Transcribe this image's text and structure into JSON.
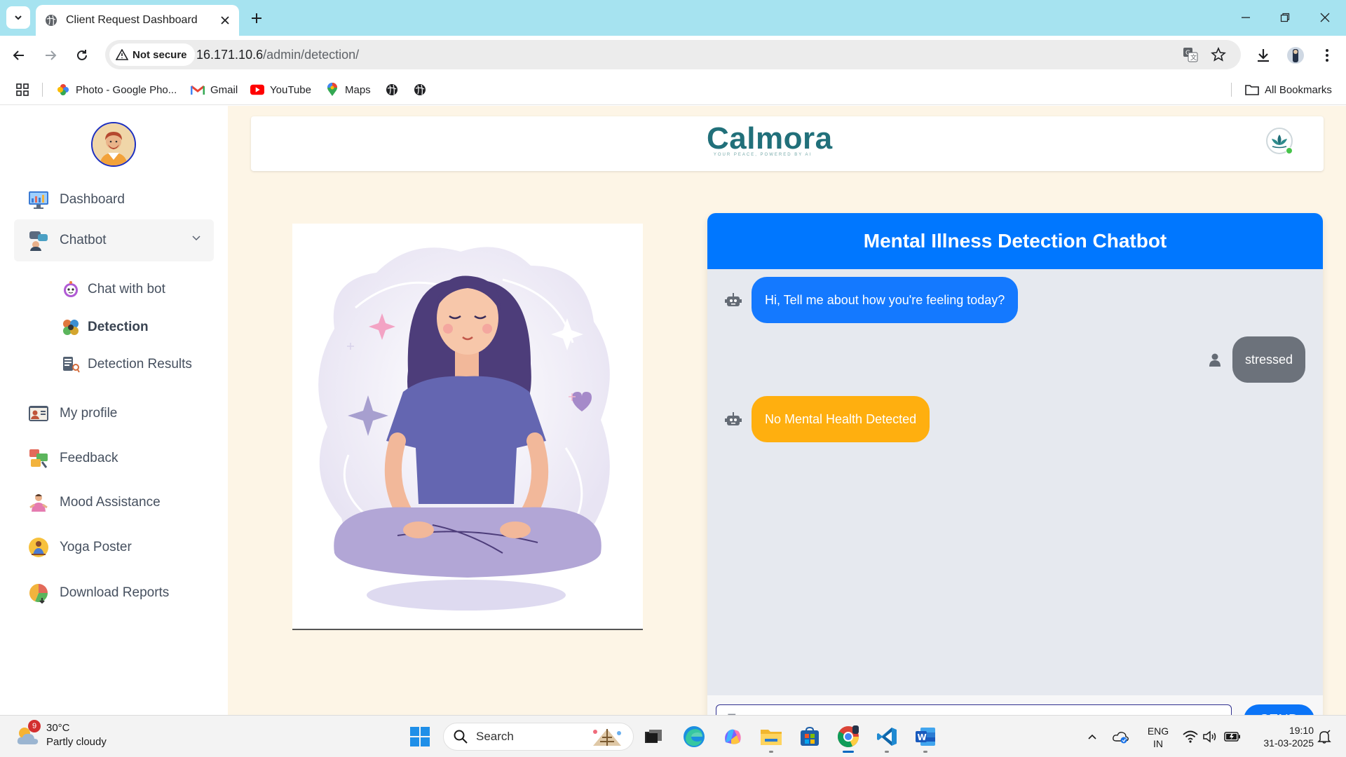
{
  "browser": {
    "tab_title": "Client Request Dashboard",
    "security_label": "Not secure",
    "url_host": "16.171.10.6",
    "url_path": "/admin/detection/",
    "bookmarks": [
      {
        "label": "Photo - Google Pho...",
        "icon": "google-photos-icon"
      },
      {
        "label": "Gmail",
        "icon": "gmail-icon"
      },
      {
        "label": "YouTube",
        "icon": "youtube-icon"
      },
      {
        "label": "Maps",
        "icon": "maps-icon"
      }
    ],
    "all_bookmarks_label": "All Bookmarks"
  },
  "sidebar": {
    "items": [
      {
        "label": "Dashboard",
        "icon": "dashboard-icon"
      },
      {
        "label": "Chatbot",
        "icon": "chatbot-icon"
      },
      {
        "label": "My profile",
        "icon": "profile-icon"
      },
      {
        "label": "Feedback",
        "icon": "feedback-icon"
      },
      {
        "label": "Mood Assistance",
        "icon": "mood-icon"
      },
      {
        "label": "Yoga Poster",
        "icon": "yoga-icon"
      },
      {
        "label": "Download Reports",
        "icon": "reports-icon"
      }
    ],
    "sub_items": [
      {
        "label": "Chat with bot",
        "icon": "bot-face-icon"
      },
      {
        "label": "Detection",
        "icon": "detection-icon"
      },
      {
        "label": "Detection Results",
        "icon": "results-icon"
      }
    ]
  },
  "header": {
    "brand": "Calmora",
    "tagline": "YOUR PEACE, POWERED BY AI"
  },
  "chat": {
    "title": "Mental Illness Detection Chatbot",
    "messages": [
      {
        "sender": "bot",
        "text": "Hi, Tell me about how you're feeling today?"
      },
      {
        "sender": "user",
        "text": "stressed"
      },
      {
        "sender": "bot",
        "text": "No Mental Health Detected"
      }
    ],
    "input_placeholder": "Type a message",
    "send_label": "SEND"
  },
  "taskbar": {
    "weather_temp": "30°C",
    "weather_desc": "Partly cloudy",
    "weather_badge": "9",
    "search_label": "Search",
    "lang_top": "ENG",
    "lang_bottom": "IN",
    "time": "19:10",
    "date": "31-03-2025"
  },
  "colors": {
    "accent": "#0077ff",
    "page_bg": "#fdf5e6",
    "alert_bubble": "#ffaf0f",
    "brand": "#21707a"
  }
}
